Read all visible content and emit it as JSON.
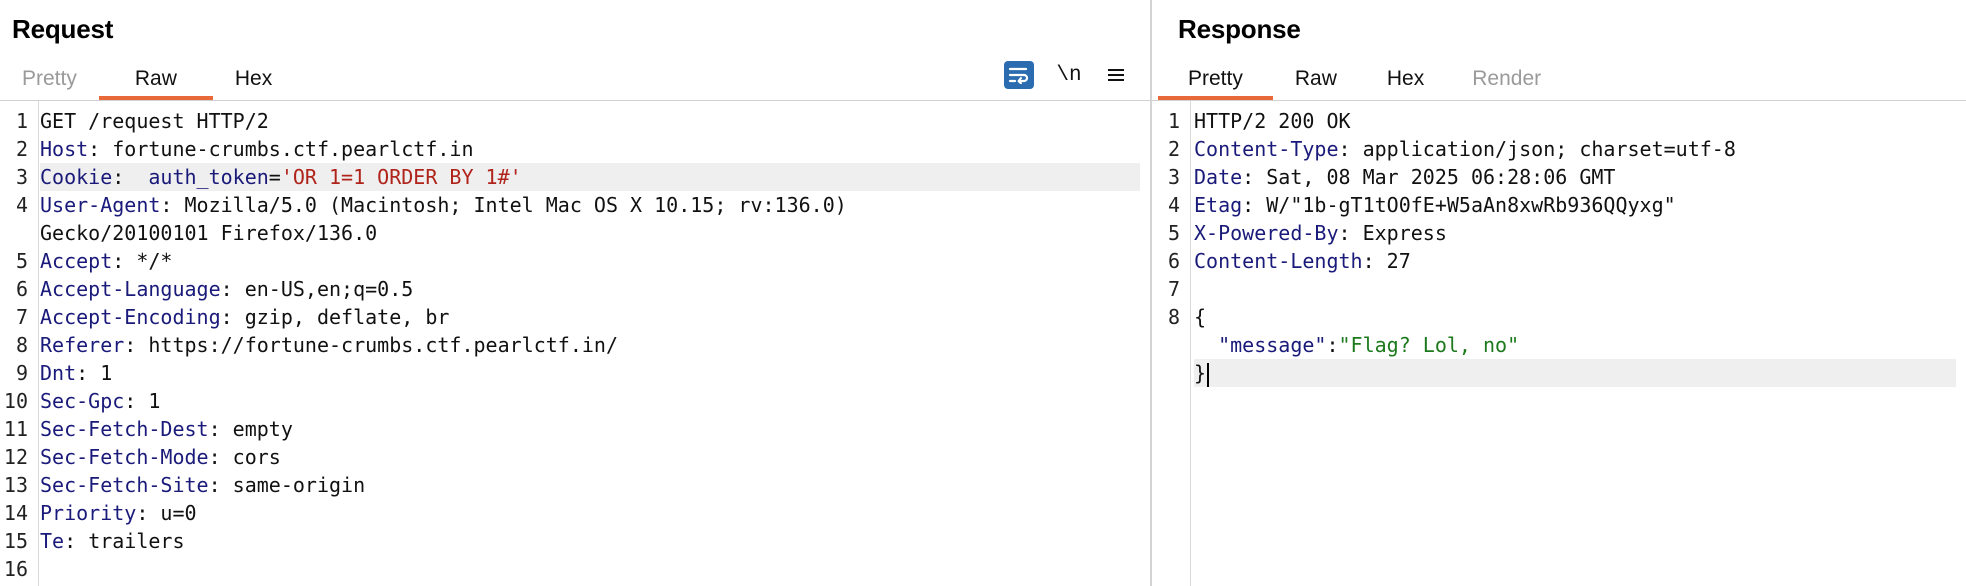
{
  "request": {
    "title": "Request",
    "tabs": [
      {
        "label": "Pretty"
      },
      {
        "label": "Raw"
      },
      {
        "label": "Hex"
      }
    ],
    "tools": {
      "newline_label": "\\n"
    },
    "lines": [
      {
        "n": "1",
        "key": "",
        "sep": "",
        "val": "GET /request HTTP/2"
      },
      {
        "n": "2",
        "key": "Host",
        "sep": ": ",
        "val": "fortune-crumbs.ctf.pearlctf.in"
      },
      {
        "n": "3",
        "key": "Cookie",
        "sep": ":  ",
        "key2": "auth_token",
        "eq": "=",
        "str": "'OR 1=1 ORDER BY 1#'"
      },
      {
        "n": "4",
        "key": "User-Agent",
        "sep": ": ",
        "val": "Mozilla/5.0 (Macintosh; Intel Mac OS X 10.15; rv:136.0)"
      },
      {
        "n": "",
        "key": "",
        "sep": "",
        "val": "Gecko/20100101 Firefox/136.0"
      },
      {
        "n": "5",
        "key": "Accept",
        "sep": ": ",
        "val": "*/*"
      },
      {
        "n": "6",
        "key": "Accept-Language",
        "sep": ": ",
        "val": "en-US,en;q=0.5"
      },
      {
        "n": "7",
        "key": "Accept-Encoding",
        "sep": ": ",
        "val": "gzip, deflate, br"
      },
      {
        "n": "8",
        "key": "Referer",
        "sep": ": ",
        "val": "https://fortune-crumbs.ctf.pearlctf.in/"
      },
      {
        "n": "9",
        "key": "Dnt",
        "sep": ": ",
        "val": "1"
      },
      {
        "n": "10",
        "key": "Sec-Gpc",
        "sep": ": ",
        "val": "1"
      },
      {
        "n": "11",
        "key": "Sec-Fetch-Dest",
        "sep": ": ",
        "val": "empty"
      },
      {
        "n": "12",
        "key": "Sec-Fetch-Mode",
        "sep": ": ",
        "val": "cors"
      },
      {
        "n": "13",
        "key": "Sec-Fetch-Site",
        "sep": ": ",
        "val": "same-origin"
      },
      {
        "n": "14",
        "key": "Priority",
        "sep": ": ",
        "val": "u=0"
      },
      {
        "n": "15",
        "key": "Te",
        "sep": ": ",
        "val": "trailers"
      },
      {
        "n": "16",
        "key": "",
        "sep": "",
        "val": ""
      }
    ]
  },
  "response": {
    "title": "Response",
    "tabs": [
      {
        "label": "Pretty"
      },
      {
        "label": "Raw"
      },
      {
        "label": "Hex"
      },
      {
        "label": "Render"
      }
    ],
    "lines": [
      {
        "n": "1",
        "key": "",
        "sep": "",
        "val": "HTTP/2 200 OK"
      },
      {
        "n": "2",
        "key": "Content-Type",
        "sep": ": ",
        "val": "application/json; charset=utf-8"
      },
      {
        "n": "3",
        "key": "Date",
        "sep": ": ",
        "val": "Sat, 08 Mar 2025 06:28:06 GMT"
      },
      {
        "n": "4",
        "key": "Etag",
        "sep": ": ",
        "val": "W/\"1b-gT1tO0fE+W5aAn8xwRb936QQyxg\""
      },
      {
        "n": "5",
        "key": "X-Powered-By",
        "sep": ": ",
        "val": "Express"
      },
      {
        "n": "6",
        "key": "Content-Length",
        "sep": ": ",
        "val": "27"
      },
      {
        "n": "7",
        "key": "",
        "sep": "",
        "val": ""
      },
      {
        "n": "8",
        "key": "",
        "sep": "",
        "val": "{"
      },
      {
        "n": "",
        "key": "",
        "sep": "",
        "indent": "  ",
        "jkey": "\"message\"",
        "colon": ":",
        "jstr": "\"Flag? Lol, no\""
      },
      {
        "n": "",
        "key": "",
        "sep": "",
        "val": "}"
      }
    ]
  },
  "colors": {
    "accent": "#e8683a",
    "header_key": "#1a1a7a",
    "string": "#b0231a",
    "json_string": "#1c7a1c",
    "wrap_button": "#2b6cb0"
  },
  "icons": [
    "wrap-lines-icon",
    "newline-icon",
    "hamburger-menu-icon"
  ]
}
